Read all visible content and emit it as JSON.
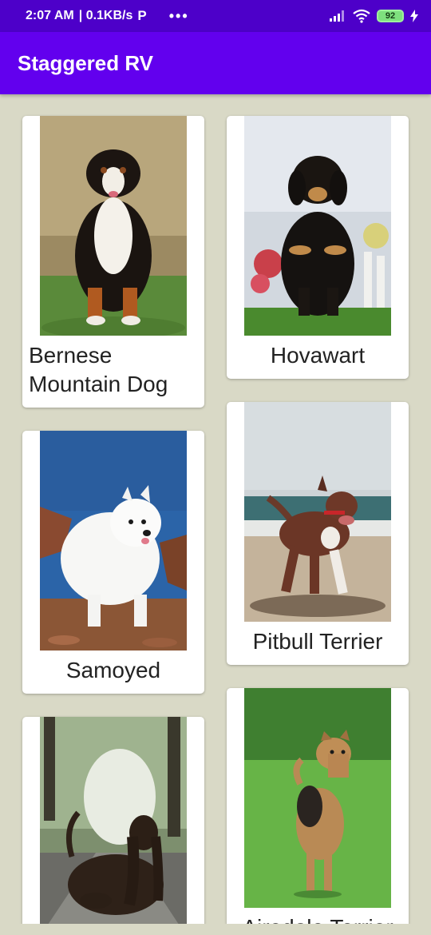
{
  "status_bar": {
    "time": "2:07 AM",
    "speed": "| 0.1KB/s",
    "p_icon": "P",
    "dots": "•••",
    "battery": "92"
  },
  "app_bar": {
    "title": "Staggered RV"
  },
  "dogs": [
    {
      "name": "Bernese Mountain Dog"
    },
    {
      "name": "Hovawart"
    },
    {
      "name": "Samoyed"
    },
    {
      "name": "Pitbull Terrier"
    },
    {
      "name": ""
    },
    {
      "name": "Airedale Terrier"
    }
  ]
}
